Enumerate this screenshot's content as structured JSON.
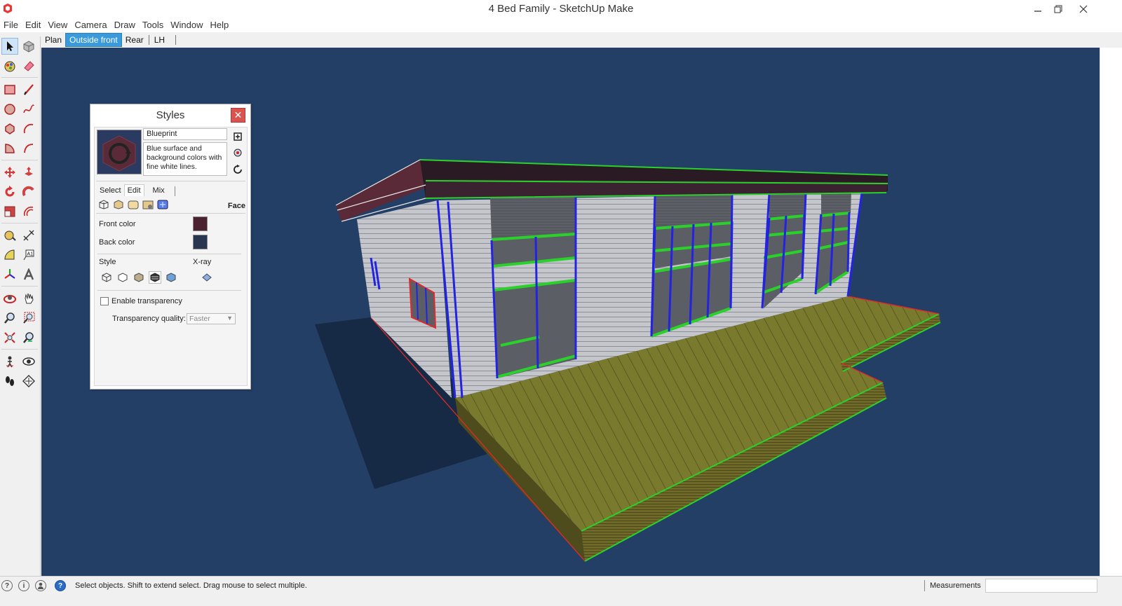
{
  "window": {
    "title": "4 Bed Family - SketchUp Make"
  },
  "menu": [
    "File",
    "Edit",
    "View",
    "Camera",
    "Draw",
    "Tools",
    "Window",
    "Help"
  ],
  "scenes": [
    "Plan",
    "Outside front",
    "Rear",
    "LH"
  ],
  "active_scene": "Outside front",
  "toolbar_icons": [
    "select-tool-icon",
    "component-tool-icon",
    "paint-bucket-icon",
    "eraser-icon",
    "rectangle-icon",
    "line-icon",
    "circle-icon",
    "freehand-icon",
    "polygon-icon",
    "arc-icon",
    "pie-icon",
    "two-point-arc-icon",
    "move-icon",
    "push-pull-icon",
    "rotate-icon",
    "follow-me-icon",
    "scale-icon",
    "offset-icon",
    "tape-measure-icon",
    "dimension-icon",
    "protractor-icon",
    "text-icon",
    "axes-icon",
    "3d-text-icon",
    "orbit-icon",
    "pan-icon",
    "zoom-icon",
    "zoom-window-icon",
    "zoom-extents-icon",
    "previous-view-icon",
    "position-camera-icon",
    "look-around-icon",
    "walk-icon",
    "section-plane-icon"
  ],
  "styles_panel": {
    "title": "Styles",
    "style_name": "Blueprint",
    "description": "Blue surface and\nbackground colors with\nfine white lines.",
    "tabs": [
      "Select",
      "Edit",
      "Mix"
    ],
    "active_tab": "Edit",
    "section_label": "Face",
    "front_color_label": "Front color",
    "back_color_label": "Back color",
    "front_color": "#4a2230",
    "back_color": "#2a3550",
    "style_label": "Style",
    "xray_label": "X-ray",
    "enable_transparency_label": "Enable transparency",
    "enable_transparency_checked": false,
    "transparency_quality_label": "Transparency quality:",
    "transparency_quality_value": "Faster"
  },
  "status": {
    "message": "Select objects. Shift to extend select. Drag mouse to select multiple.",
    "measurements_label": "Measurements",
    "measurements_value": ""
  },
  "colors": {
    "viewport_background": "#233f66",
    "selected_scene": "#3a9bdc",
    "close_button": "#d9534f"
  }
}
